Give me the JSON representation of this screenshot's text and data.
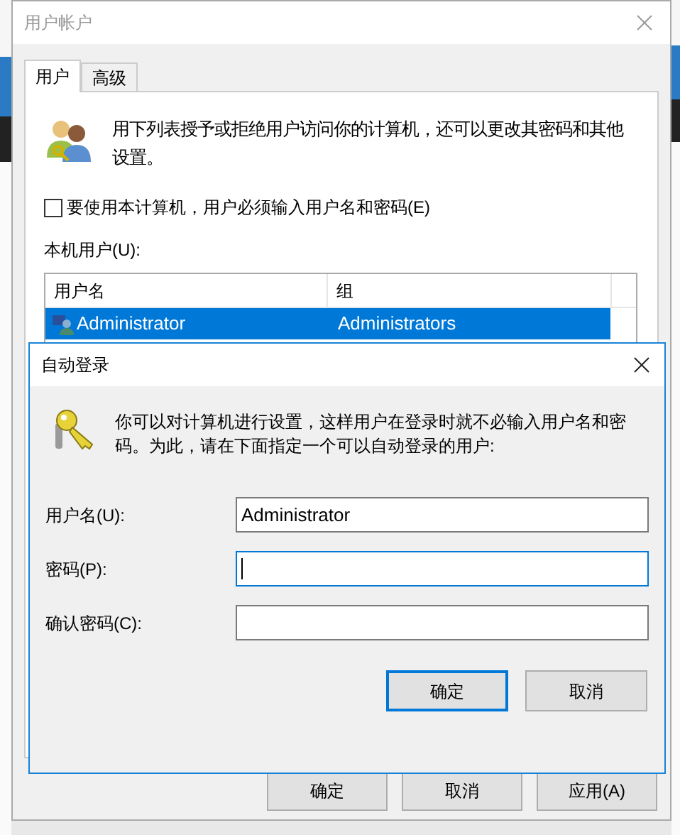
{
  "window": {
    "title": "用户帐户",
    "active": false
  },
  "tabs": [
    {
      "label": "用户",
      "selected": true
    },
    {
      "label": "高级",
      "selected": false
    }
  ],
  "description": "用下列表授予或拒绝用户访问你的计算机，还可以更改其密码和其他设置。",
  "require_login": {
    "label": "要使用本计算机，用户必须输入用户名和密码(E)",
    "checked": false
  },
  "users_label": "本机用户(U):",
  "users_table": {
    "columns": [
      "用户名",
      "组"
    ],
    "rows": [
      {
        "cells": [
          "Administrator",
          "Administrators"
        ],
        "selected": true
      }
    ]
  },
  "buttons": [
    {
      "label": "确定"
    },
    {
      "label": "取消"
    },
    {
      "label": "应用(A)"
    }
  ],
  "auto_login": {
    "title": "自动登录",
    "active": true,
    "description": "你可以对计算机进行设置，这样用户在登录时就不必输入用户名和密码。为此，请在下面指定一个可以自动登录的用户:",
    "fields": [
      {
        "label": "用户名(U):",
        "value": "Administrator",
        "focused": false
      },
      {
        "label": "密码(P):",
        "focused": true
      },
      {
        "label": "确认密码(C):",
        "focused": false
      }
    ],
    "buttons": [
      {
        "label": "确定",
        "default": true
      },
      {
        "label": "取消",
        "default": false
      }
    ]
  }
}
